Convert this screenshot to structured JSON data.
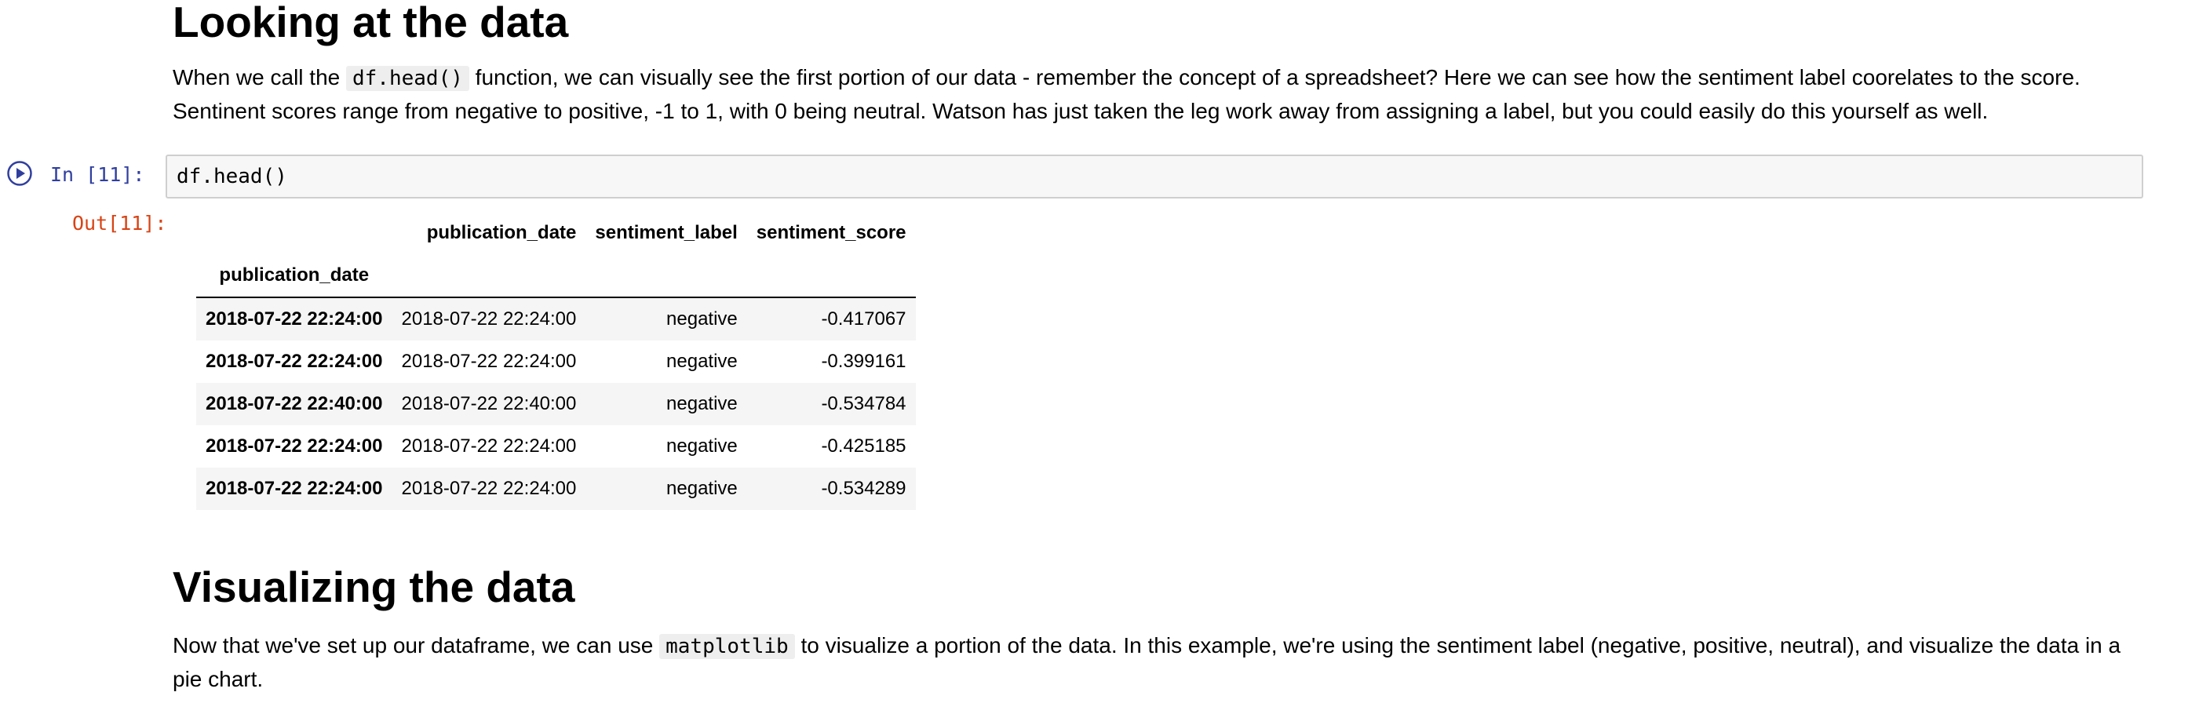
{
  "section1": {
    "heading": "Looking at the data",
    "para_before_code": "When we call the ",
    "inline_code": "df.head()",
    "para_after_code": " function, we can visually see the first portion of our data - remember the concept of a spreadsheet? Here we can see how the sentiment label coorelates to the score. Sentinent scores range from negative to positive, -1 to 1, with 0 being neutral. Watson has just taken the leg work away from assigning a label, but you could easily do this yourself as well."
  },
  "cell": {
    "in_prompt": "In [11]:",
    "code": "df.head()",
    "out_prompt": "Out[11]:",
    "run_icon": "play-circle-icon"
  },
  "dataframe": {
    "index_name": "publication_date",
    "columns": [
      "publication_date",
      "sentiment_label",
      "sentiment_score"
    ],
    "rows": [
      {
        "index": "2018-07-22 22:24:00",
        "publication_date": "2018-07-22 22:24:00",
        "sentiment_label": "negative",
        "sentiment_score": "-0.417067"
      },
      {
        "index": "2018-07-22 22:24:00",
        "publication_date": "2018-07-22 22:24:00",
        "sentiment_label": "negative",
        "sentiment_score": "-0.399161"
      },
      {
        "index": "2018-07-22 22:40:00",
        "publication_date": "2018-07-22 22:40:00",
        "sentiment_label": "negative",
        "sentiment_score": "-0.534784"
      },
      {
        "index": "2018-07-22 22:24:00",
        "publication_date": "2018-07-22 22:24:00",
        "sentiment_label": "negative",
        "sentiment_score": "-0.425185"
      },
      {
        "index": "2018-07-22 22:24:00",
        "publication_date": "2018-07-22 22:24:00",
        "sentiment_label": "negative",
        "sentiment_score": "-0.534289"
      }
    ]
  },
  "section2": {
    "heading": "Visualizing the data",
    "para_before_code": "Now that we've set up our dataframe, we can use ",
    "inline_code": "matplotlib",
    "para_after_code": " to visualize a portion of the data. In this example, we're using the sentiment label (negative, positive, neutral), and visualize the data in a pie chart."
  },
  "colors": {
    "in_prompt": "#303f9f",
    "out_prompt": "#d84315",
    "run_icon": "#303f9f"
  }
}
